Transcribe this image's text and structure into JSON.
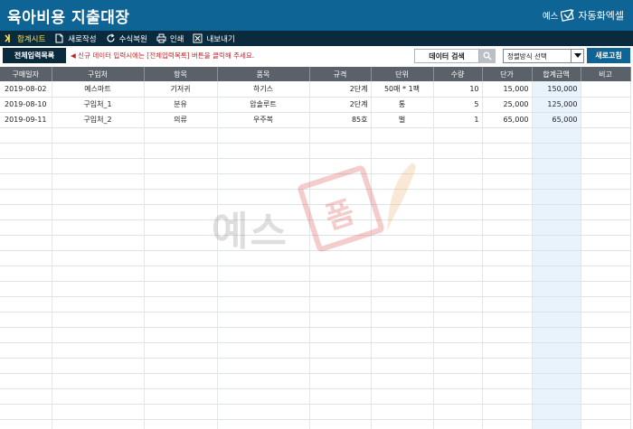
{
  "app": {
    "title": "육아비용 지출대장",
    "brand_prefix": "예스",
    "brand_name": "자동화엑셀"
  },
  "toolbar": {
    "items": [
      {
        "label": "합계시트",
        "icon": "chevron-right-icon",
        "active": true
      },
      {
        "label": "새로작성",
        "icon": "new-document-icon"
      },
      {
        "label": "수식복원",
        "icon": "refresh-icon"
      },
      {
        "label": "인쇄",
        "icon": "printer-icon"
      },
      {
        "label": "내보내기",
        "icon": "excel-export-icon"
      }
    ]
  },
  "actionbar": {
    "all_entries_label": "전체입력목록",
    "notice": "◀ 신규 데이터 입력시에는 [전체입력목록] 버튼을 클릭해 주세요.",
    "search_label": "데이터 검색",
    "sort_placeholder": "정렬방식 선택",
    "refresh_label": "새로고침"
  },
  "table": {
    "columns": [
      "구매일자",
      "구입처",
      "항목",
      "품목",
      "규격",
      "단위",
      "수량",
      "단가",
      "합계금액",
      "비고"
    ],
    "rows": [
      [
        "2019-08-02",
        "예스마트",
        "기저귀",
        "하기스",
        "2단계",
        "50매 * 1팩",
        "10",
        "15,000",
        "150,000",
        ""
      ],
      [
        "2019-08-10",
        "구입처_1",
        "분유",
        "압솔루트",
        "2단계",
        "통",
        "5",
        "25,000",
        "125,000",
        ""
      ],
      [
        "2019-09-11",
        "구입처_2",
        "의류",
        "우주복",
        "85호",
        "벌",
        "1",
        "65,000",
        "65,000",
        ""
      ]
    ],
    "empty_rows": 20
  },
  "watermark": {
    "text": "예스",
    "stamp_text": "폼"
  },
  "colors": {
    "title_bar": "#0f6496",
    "toolbar": "#0a2a3d",
    "header": "#5a6168",
    "notice": "#c0242b",
    "sum_column": "#e8f3fb",
    "active_tab": "#ffe34a"
  }
}
